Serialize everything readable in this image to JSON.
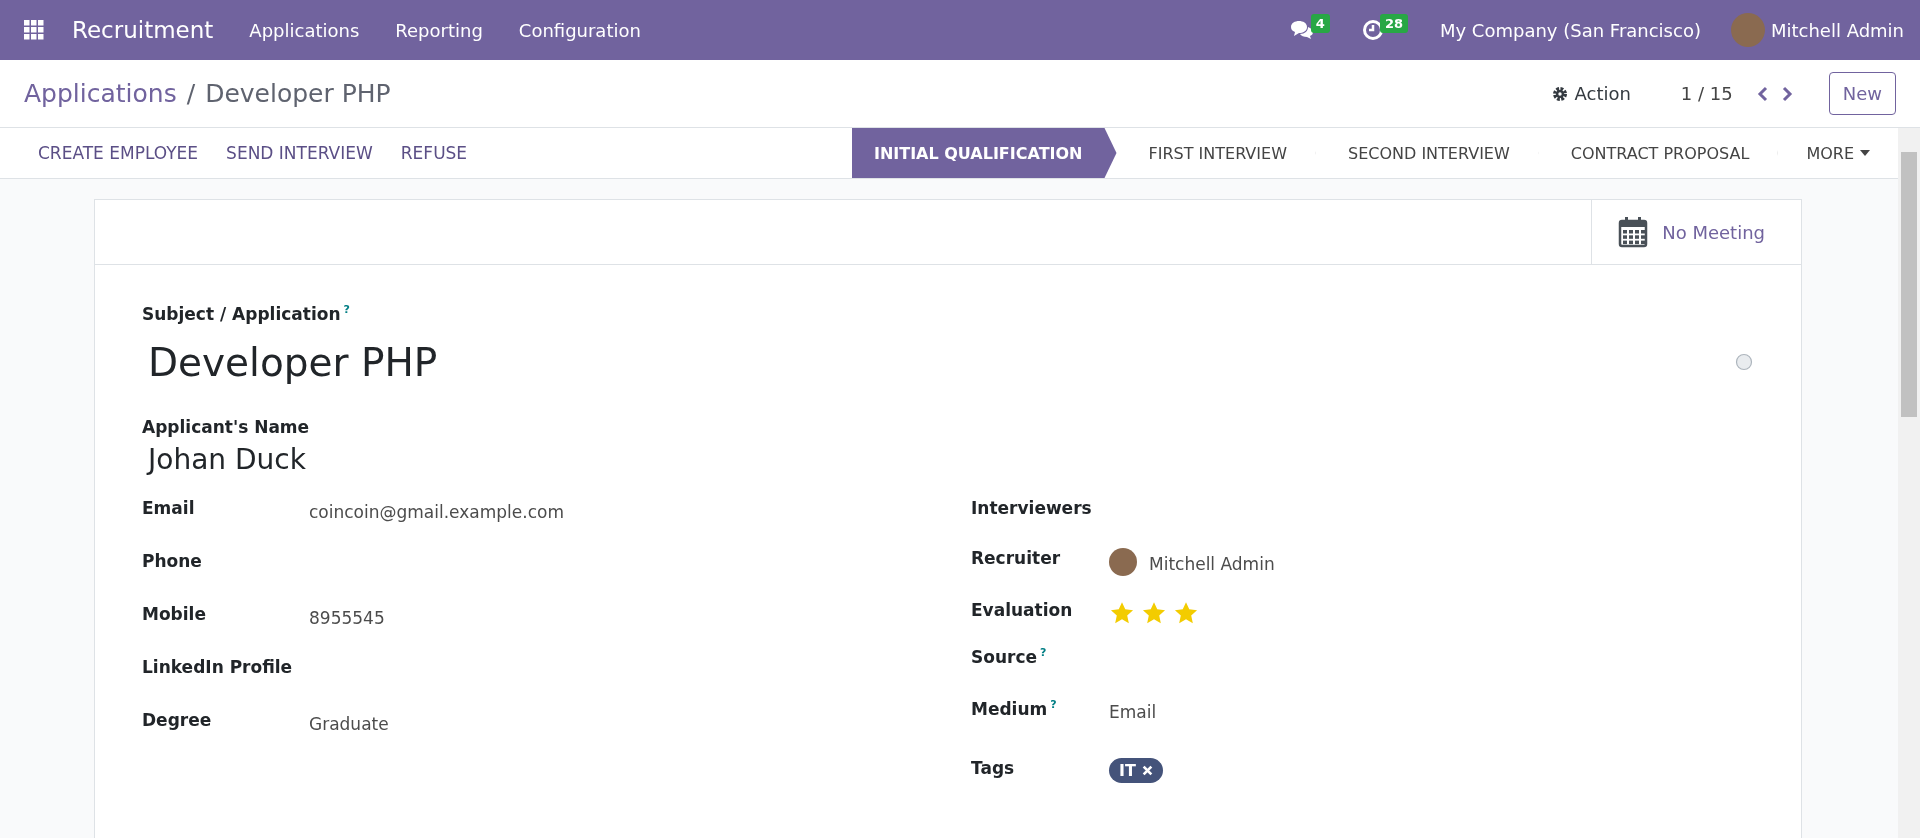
{
  "navbar": {
    "app": "Recruitment",
    "menus": [
      "Applications",
      "Reporting",
      "Configuration"
    ],
    "messages_count": "4",
    "activities_count": "28",
    "company": "My Company (San Francisco)",
    "user": "Mitchell Admin"
  },
  "breadcrumb": {
    "parent": "Applications",
    "separator": "/",
    "current": "Developer PHP"
  },
  "control": {
    "action": "Action",
    "pager": "1 / 15",
    "new_button": "New"
  },
  "actions": [
    "CREATE EMPLOYEE",
    "SEND INTERVIEW",
    "REFUSE"
  ],
  "stages": [
    {
      "label": "INITIAL QUALIFICATION",
      "selected": true
    },
    {
      "label": "FIRST INTERVIEW",
      "selected": false
    },
    {
      "label": "SECOND INTERVIEW",
      "selected": false
    },
    {
      "label": "CONTRACT PROPOSAL",
      "selected": false
    }
  ],
  "more": "MORE",
  "meeting_button": "No Meeting",
  "form": {
    "subject_label": "Subject / Application$^{?}$",
    "subject": "Developer PHP",
    "name_label": "Applicant's Name",
    "name": "Johan Duck",
    "left": [
      {
        "label": "Email",
        "value": "coincoin@gmail.example.com"
      },
      {
        "label": "Phone"
      },
      {
        "label": "Mobile",
        "value": "8955545"
      },
      {
        "label": "LinkedIn Profile"
      },
      {
        "label": "Degree",
        "value": "Graduate"
      }
    ],
    "right": [
      {
        "kind": "text",
        "label": "Interviewers"
      },
      {
        "kind": "avatar",
        "label": "Recruiter",
        "value": "Mitchell Admin"
      },
      {
        "kind": "stars",
        "label": "Evaluation",
        "stars": 3
      },
      {
        "kind": "text",
        "label": "Source$^{?}$"
      },
      {
        "kind": "text",
        "label": "Medium$^{?}$",
        "value": "Email"
      },
      {
        "kind": "tag",
        "label": "Tags",
        "value": "IT"
      }
    ]
  }
}
